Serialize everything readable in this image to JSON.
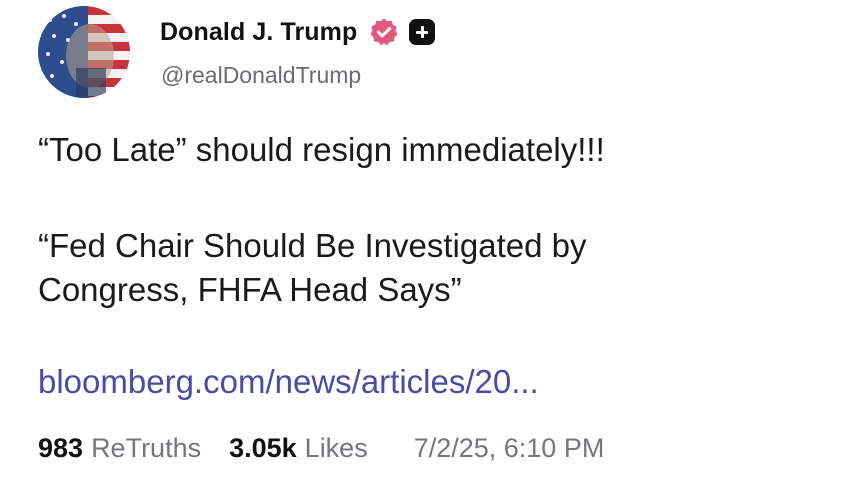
{
  "post": {
    "display_name": "Donald J. Trump",
    "handle": "@realDonaldTrump",
    "verified_icon": "verified-badge-icon",
    "plus_icon": "plus-icon",
    "verified_color": "#e2587e",
    "text_line1": "“Too Late” should resign immediately!!!",
    "quote_line1": "“Fed Chair Should Be Investigated by",
    "quote_line2": "Congress, FHFA Head Says”",
    "link": "bloomberg.com/news/articles/20...",
    "link_color": "#4b4aa8"
  },
  "stats": {
    "retruths_count": "983",
    "retruths_label": "ReTruths",
    "likes_count": "3.05k",
    "likes_label": "Likes",
    "timestamp": "7/2/25, 6:10 PM"
  }
}
